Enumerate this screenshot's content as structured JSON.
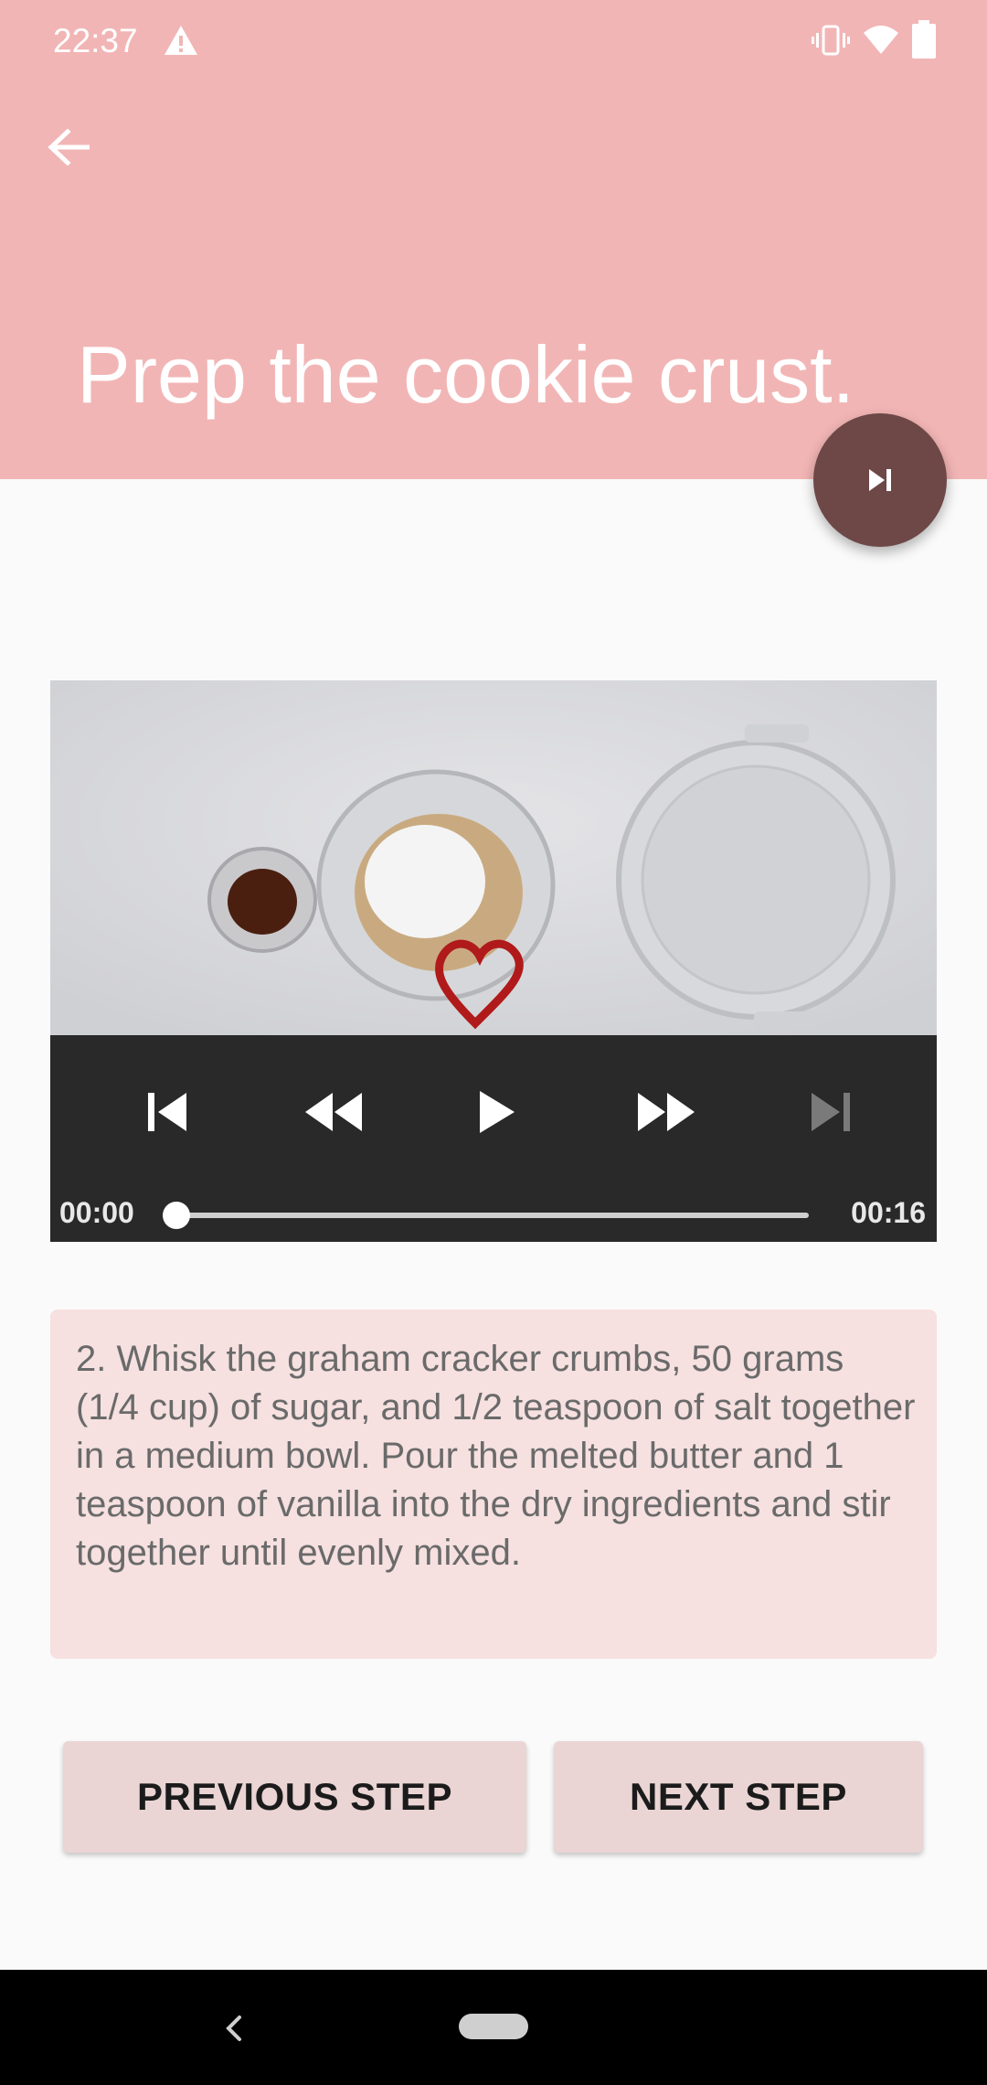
{
  "status_bar": {
    "time": "22:37",
    "icons": [
      "alert-icon",
      "vibrate-icon",
      "wifi-icon",
      "battery-icon"
    ]
  },
  "app_bar": {
    "back_icon": "arrow-left-icon",
    "title": "Prep the cookie crust.",
    "fab_icon": "skip-next-icon"
  },
  "video": {
    "controls": [
      "skip-previous-icon",
      "rewind-icon",
      "play-icon",
      "fast-forward-icon",
      "skip-next-icon"
    ],
    "current_time": "00:00",
    "duration": "00:16",
    "progress": 0
  },
  "step": {
    "description": "2. Whisk the graham cracker crumbs, 50 grams (1/4 cup) of sugar, and 1/2 teaspoon of salt together in a medium bowl. Pour the melted butter and 1 teaspoon of vanilla into the dry ingredients and stir together until evenly mixed."
  },
  "buttons": {
    "previous": "PREVIOUS STEP",
    "next": "NEXT STEP"
  },
  "colors": {
    "header": "#f2b5b5",
    "fab": "#6e4747",
    "card": "#f6e0e0",
    "button": "#ead4d4"
  }
}
